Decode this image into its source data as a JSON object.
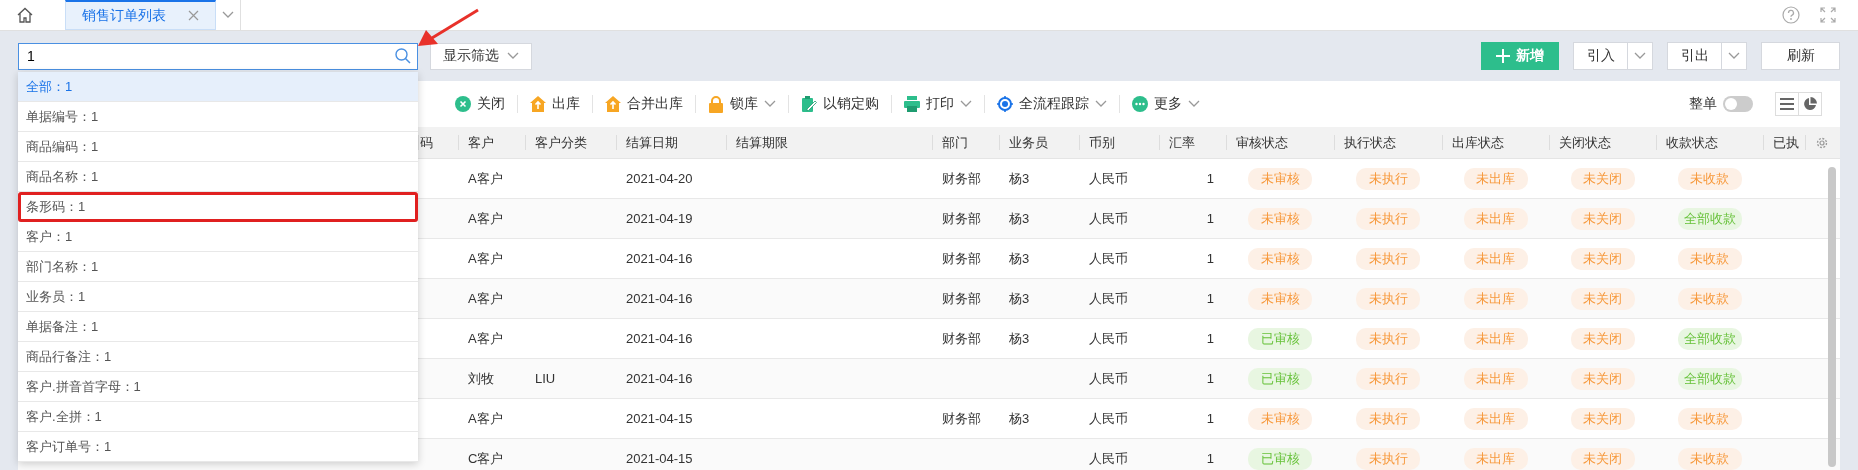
{
  "top_bar": {
    "tabs": [
      {
        "label": "销售订单列表",
        "selected": true
      }
    ]
  },
  "search": {
    "value": "1"
  },
  "filter_button": "显示筛选",
  "actions": [
    {
      "label": "新增",
      "kind": "primary"
    },
    {
      "label": "引入",
      "kind": "split"
    },
    {
      "label": "引出",
      "kind": "split"
    },
    {
      "label": "刷新",
      "kind": "plain"
    }
  ],
  "toolbar": [
    {
      "label": "关闭",
      "kind": "close",
      "menu": false
    },
    {
      "label": "出库",
      "kind": "outbound",
      "menu": false
    },
    {
      "label": "合并出库",
      "kind": "outbound",
      "menu": false
    },
    {
      "label": "锁库",
      "kind": "lock",
      "menu": true
    },
    {
      "label": "以销定购",
      "kind": "purchase",
      "menu": false
    },
    {
      "label": "打印",
      "kind": "print",
      "menu": true
    },
    {
      "label": "全流程跟踪",
      "kind": "track",
      "menu": true
    },
    {
      "label": "更多",
      "kind": "more",
      "menu": true
    }
  ],
  "whole_order": {
    "label": "整单",
    "on": false
  },
  "table": {
    "columns": [
      "码",
      "客户",
      "客户分类",
      "结算日期",
      "结算期限",
      "部门",
      "业务员",
      "币别",
      "汇率",
      "审核状态",
      "执行状态",
      "出库状态",
      "关闭状态",
      "收款状态",
      "已执"
    ],
    "rows": [
      {
        "cells": [
          "",
          "A客户",
          "",
          "2021-04-20",
          "",
          "财务部",
          "杨3",
          "人民币",
          "1"
        ],
        "statuses": [
          {
            "label": "未审核",
            "kind": "pending"
          },
          {
            "label": "未执行",
            "kind": "pending"
          },
          {
            "label": "未出库",
            "kind": "pending"
          },
          {
            "label": "未关闭",
            "kind": "pending"
          },
          {
            "label": "未收款",
            "kind": "pending"
          }
        ]
      },
      {
        "cells": [
          "",
          "A客户",
          "",
          "2021-04-19",
          "",
          "财务部",
          "杨3",
          "人民币",
          "1"
        ],
        "statuses": [
          {
            "label": "未审核",
            "kind": "pending"
          },
          {
            "label": "未执行",
            "kind": "pending"
          },
          {
            "label": "未出库",
            "kind": "pending"
          },
          {
            "label": "未关闭",
            "kind": "pending"
          },
          {
            "label": "全部收款",
            "kind": "done"
          }
        ]
      },
      {
        "cells": [
          "",
          "A客户",
          "",
          "2021-04-16",
          "",
          "财务部",
          "杨3",
          "人民币",
          "1"
        ],
        "statuses": [
          {
            "label": "未审核",
            "kind": "pending"
          },
          {
            "label": "未执行",
            "kind": "pending"
          },
          {
            "label": "未出库",
            "kind": "pending"
          },
          {
            "label": "未关闭",
            "kind": "pending"
          },
          {
            "label": "未收款",
            "kind": "pending"
          }
        ]
      },
      {
        "cells": [
          "",
          "A客户",
          "",
          "2021-04-16",
          "",
          "财务部",
          "杨3",
          "人民币",
          "1"
        ],
        "statuses": [
          {
            "label": "未审核",
            "kind": "pending"
          },
          {
            "label": "未执行",
            "kind": "pending"
          },
          {
            "label": "未出库",
            "kind": "pending"
          },
          {
            "label": "未关闭",
            "kind": "pending"
          },
          {
            "label": "未收款",
            "kind": "pending"
          }
        ]
      },
      {
        "cells": [
          "",
          "A客户",
          "",
          "2021-04-16",
          "",
          "财务部",
          "杨3",
          "人民币",
          "1"
        ],
        "statuses": [
          {
            "label": "已审核",
            "kind": "done"
          },
          {
            "label": "未执行",
            "kind": "pending"
          },
          {
            "label": "未出库",
            "kind": "pending"
          },
          {
            "label": "未关闭",
            "kind": "pending"
          },
          {
            "label": "全部收款",
            "kind": "done"
          }
        ]
      },
      {
        "cells": [
          "",
          "刘牧",
          "LIU",
          "2021-04-16",
          "",
          "",
          "",
          "人民币",
          "1"
        ],
        "statuses": [
          {
            "label": "已审核",
            "kind": "done"
          },
          {
            "label": "未执行",
            "kind": "pending"
          },
          {
            "label": "未出库",
            "kind": "pending"
          },
          {
            "label": "未关闭",
            "kind": "pending"
          },
          {
            "label": "全部收款",
            "kind": "done"
          }
        ]
      },
      {
        "cells": [
          "",
          "A客户",
          "",
          "2021-04-15",
          "",
          "财务部",
          "杨3",
          "人民币",
          "1"
        ],
        "statuses": [
          {
            "label": "未审核",
            "kind": "pending"
          },
          {
            "label": "未执行",
            "kind": "pending"
          },
          {
            "label": "未出库",
            "kind": "pending"
          },
          {
            "label": "未关闭",
            "kind": "pending"
          },
          {
            "label": "未收款",
            "kind": "pending"
          }
        ]
      },
      {
        "cells": [
          "",
          "C客户",
          "",
          "2021-04-15",
          "",
          "",
          "",
          "人民币",
          "1"
        ],
        "statuses": [
          {
            "label": "已审核",
            "kind": "done"
          },
          {
            "label": "未执行",
            "kind": "pending"
          },
          {
            "label": "未出库",
            "kind": "pending"
          },
          {
            "label": "未关闭",
            "kind": "pending"
          },
          {
            "label": "未收款",
            "kind": "pending"
          }
        ]
      }
    ]
  },
  "dropdown": [
    {
      "text": "全部：1",
      "selected": true,
      "marked": false
    },
    {
      "text": "单据编号：1",
      "selected": false,
      "marked": false
    },
    {
      "text": "商品编码：1",
      "selected": false,
      "marked": false
    },
    {
      "text": "商品名称：1",
      "selected": false,
      "marked": false
    },
    {
      "text": "条形码：1",
      "selected": false,
      "marked": true
    },
    {
      "text": "客户：1",
      "selected": false,
      "marked": false
    },
    {
      "text": "部门名称：1",
      "selected": false,
      "marked": false
    },
    {
      "text": "业务员：1",
      "selected": false,
      "marked": false
    },
    {
      "text": "单据备注：1",
      "selected": false,
      "marked": false
    },
    {
      "text": "商品行备注：1",
      "selected": false,
      "marked": false
    },
    {
      "text": "客户.拼音首字母：1",
      "selected": false,
      "marked": false
    },
    {
      "text": "客户.全拼：1",
      "selected": false,
      "marked": false
    },
    {
      "text": "客户订单号：1",
      "selected": false,
      "marked": false
    }
  ]
}
